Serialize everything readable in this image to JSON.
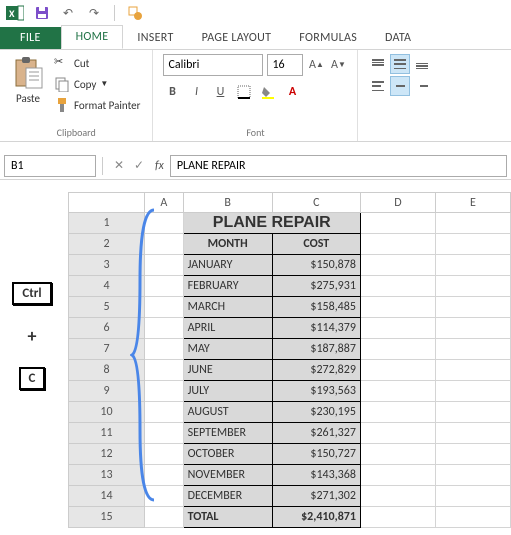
{
  "qat": {
    "save": "",
    "undo": "",
    "redo": ""
  },
  "tabs": {
    "file": "FILE",
    "home": "HOME",
    "insert": "INSERT",
    "pagelayout": "PAGE LAYOUT",
    "formulas": "FORMULAS",
    "data": "DATA"
  },
  "ribbon": {
    "clipboard": {
      "label": "Clipboard",
      "paste": "Paste",
      "cut": "Cut",
      "copy": "Copy",
      "formatpainter": "Format Painter"
    },
    "font": {
      "label": "Font",
      "name": "Calibri",
      "size": "16",
      "bold": "B",
      "italic": "I",
      "underline": "U"
    }
  },
  "formula_bar": {
    "namebox": "B1",
    "value": "PLANE REPAIR"
  },
  "columns": [
    "A",
    "B",
    "C",
    "D",
    "E"
  ],
  "rows": [
    "1",
    "2",
    "3",
    "4",
    "5",
    "6",
    "7",
    "8",
    "9",
    "10",
    "11",
    "12",
    "13",
    "14",
    "15"
  ],
  "table": {
    "title": "PLANE REPAIR",
    "col1": "MONTH",
    "col2": "COST",
    "data": [
      {
        "m": "JANUARY",
        "v": "$150,878"
      },
      {
        "m": "FEBRUARY",
        "v": "$275,931"
      },
      {
        "m": "MARCH",
        "v": "$158,485"
      },
      {
        "m": "APRIL",
        "v": "$114,379"
      },
      {
        "m": "MAY",
        "v": "$187,887"
      },
      {
        "m": "JUNE",
        "v": "$272,829"
      },
      {
        "m": "JULY",
        "v": "$193,563"
      },
      {
        "m": "AUGUST",
        "v": "$230,195"
      },
      {
        "m": "SEPTEMBER",
        "v": "$261,327"
      },
      {
        "m": "OCTOBER",
        "v": "$150,727"
      },
      {
        "m": "NOVEMBER",
        "v": "$143,368"
      },
      {
        "m": "DECEMBER",
        "v": "$271,302"
      }
    ],
    "total_label": "TOTAL",
    "total_value": "$2,410,871"
  },
  "keys": {
    "ctrl": "Ctrl",
    "plus": "+",
    "c": "C"
  }
}
